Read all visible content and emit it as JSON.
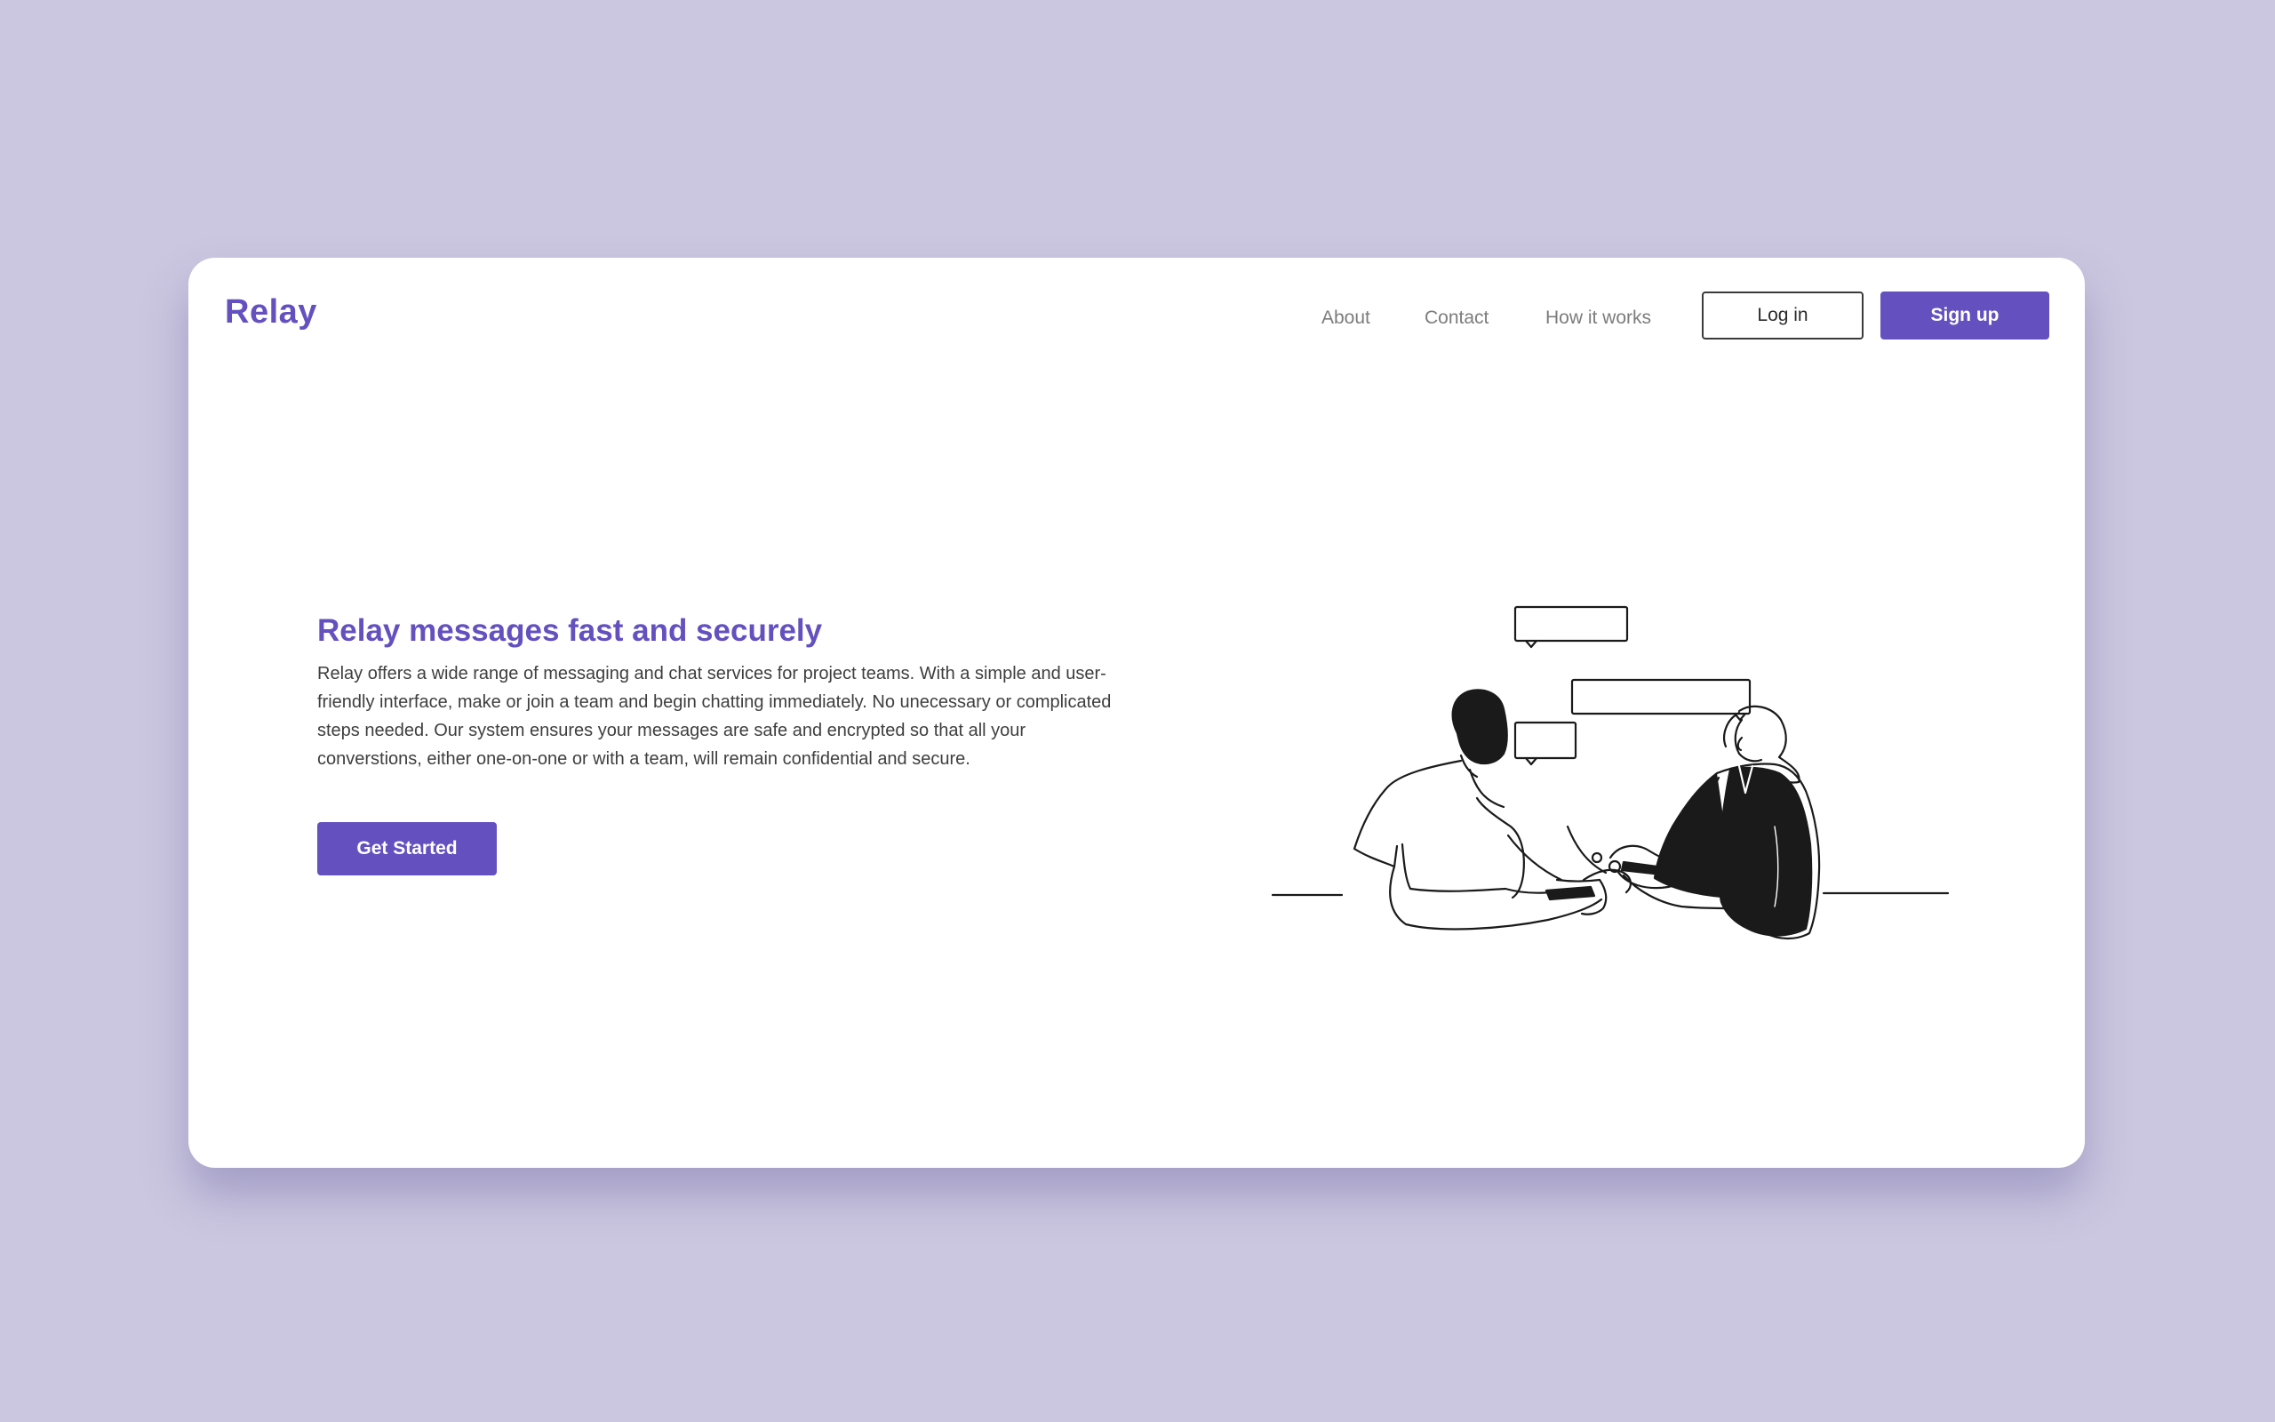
{
  "brand": {
    "name": "Relay",
    "color": "#6450bf"
  },
  "nav": {
    "links": [
      "About",
      "Contact",
      "How it works"
    ],
    "login_label": "Log in",
    "signup_label": "Sign up"
  },
  "hero": {
    "title": "Relay messages fast and securely",
    "body": "Relay offers a wide range of messaging and chat services for project teams. With a simple and user-friendly interface, make or join a team and begin chatting immediately. No unecessary or complicated steps needed. Our system ensures your messages are safe and encrypted so that all your converstions, either one-on-one or with a team, will remain confidential and secure.",
    "cta_label": "Get Started"
  },
  "illustration": {
    "description_icon": "two-people-chatting-illustration-icon"
  },
  "colors": {
    "background": "#cbc7e0",
    "accent": "#6450bf",
    "card": "#ffffff"
  }
}
